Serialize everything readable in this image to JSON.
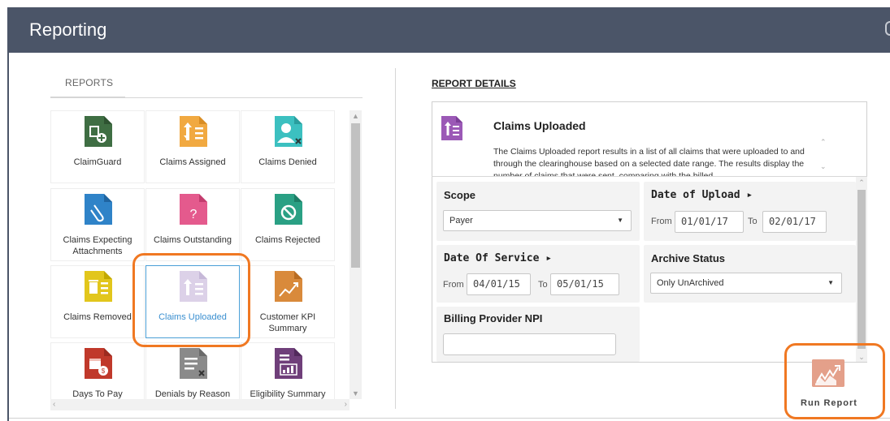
{
  "header": {
    "title": "Reporting"
  },
  "reports": {
    "tab_label": "REPORTS",
    "tiles": [
      {
        "label": "ClaimGuard",
        "icon": "claimguard-icon",
        "color": "#3f6e43"
      },
      {
        "label": "Claims Assigned",
        "icon": "claims-assigned-icon",
        "color": "#f1a941"
      },
      {
        "label": "Claims Denied",
        "icon": "claims-denied-icon",
        "color": "#3cc0c0"
      },
      {
        "label": "Claims Expecting Attachments",
        "icon": "claims-expecting-attachments-icon",
        "color": "#2f83c8"
      },
      {
        "label": "Claims Outstanding",
        "icon": "claims-outstanding-icon",
        "color": "#e45a8d"
      },
      {
        "label": "Claims Rejected",
        "icon": "claims-rejected-icon",
        "color": "#2aa084"
      },
      {
        "label": "Claims Removed",
        "icon": "claims-removed-icon",
        "color": "#e2c61c"
      },
      {
        "label": "Claims Uploaded",
        "icon": "claims-uploaded-icon",
        "color": "#d9cfe6"
      },
      {
        "label": "Customer KPI Summary",
        "icon": "customer-kpi-summary-icon",
        "color": "#d98a3b"
      },
      {
        "label": "Days To Pay",
        "icon": "days-to-pay-icon",
        "color": "#c0392b"
      },
      {
        "label": "Denials by Reason",
        "icon": "denials-by-reason-icon",
        "color": "#8a8a8a"
      },
      {
        "label": "Eligibility Summary",
        "icon": "eligibility-summary-icon",
        "color": "#6f3f7a"
      }
    ]
  },
  "details": {
    "title": "REPORT DETAILS",
    "report_title": "Claims Uploaded",
    "report_icon": "claims-uploaded-icon",
    "report_icon_color": "#9b59b6",
    "description": "The Claims Uploaded report results in a list of all claims that were uploaded to and through the clearinghouse based on a selected date range. The results display the number of claims that were sent, comparing with the billed"
  },
  "form": {
    "scope": {
      "label": "Scope",
      "value": "Payer"
    },
    "date_of_upload": {
      "label": "Date of Upload ▸",
      "from_label": "From",
      "from": "01/01/17",
      "to_label": "To",
      "to": "02/01/17"
    },
    "date_of_service": {
      "label": "Date Of Service ▸",
      "from_label": "From",
      "from": "04/01/15",
      "to_label": "To",
      "to": "05/01/15"
    },
    "archive_status": {
      "label": "Archive Status",
      "value": "Only UnArchived"
    },
    "billing_provider_npi": {
      "label": "Billing Provider NPI",
      "value": ""
    }
  },
  "run_report": {
    "label": "Run Report",
    "icon": "run-report-chart-icon",
    "color": "#e4a08a"
  },
  "accent": {
    "highlight": "#f07822",
    "header_bg": "#4b5568"
  }
}
